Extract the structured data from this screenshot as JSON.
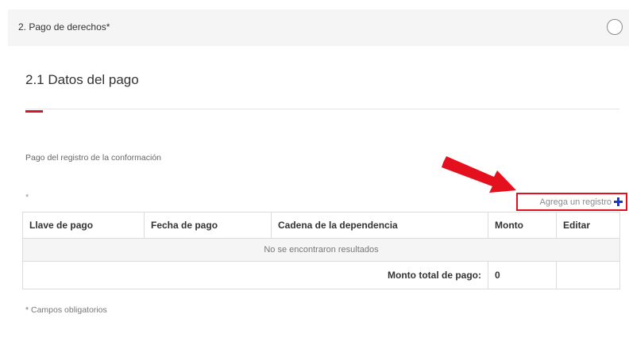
{
  "section": {
    "title": "2. Pago de derechos*"
  },
  "subsection": {
    "title": "2.1 Datos del pago"
  },
  "form": {
    "field_label": "Pago del registro de la conformación",
    "required_marker": "*",
    "add_record_label": "Agrega un registro"
  },
  "table": {
    "headers": [
      "Llave de pago",
      "Fecha de pago",
      "Cadena de la dependencia",
      "Monto",
      "Editar"
    ],
    "empty_message": "No se encontraron resultados",
    "total_label": "Monto total de pago:",
    "total_value": "0"
  },
  "footer": {
    "note": "* Campos obligatorios"
  },
  "colors": {
    "accent_red": "#d3152c",
    "highlight_red": "#e0101e",
    "plus_blue": "#1338d6",
    "header_bg": "#f5f5f5"
  },
  "icons": {
    "status": "circle-outline-icon",
    "add": "plus-icon",
    "annotation": "red-arrow-icon"
  }
}
